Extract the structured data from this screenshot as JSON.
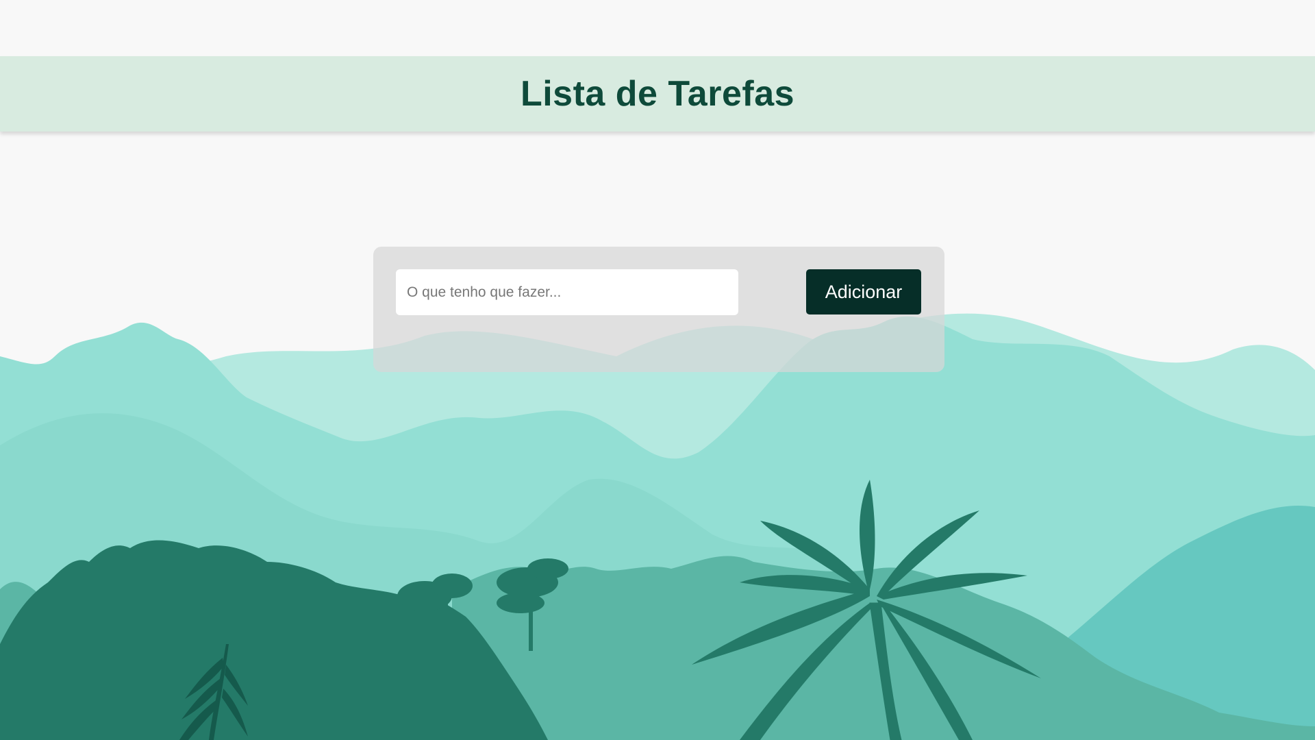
{
  "header": {
    "title": "Lista de Tarefas"
  },
  "task_form": {
    "input_placeholder": "O que tenho que fazer...",
    "input_value": "",
    "add_button_label": "Adicionar"
  },
  "colors": {
    "page_background": "#f8f8f8",
    "header_background": "#d8ebe0",
    "title_color": "#0e4a3a",
    "button_background": "#062e28",
    "card_background": "#d7d7d7",
    "mountain_far": "#b4e9e0",
    "mountain_mid": "#93dfd4",
    "jungle_dark": "#247a68",
    "jungle_mid": "#5bb6a5"
  }
}
